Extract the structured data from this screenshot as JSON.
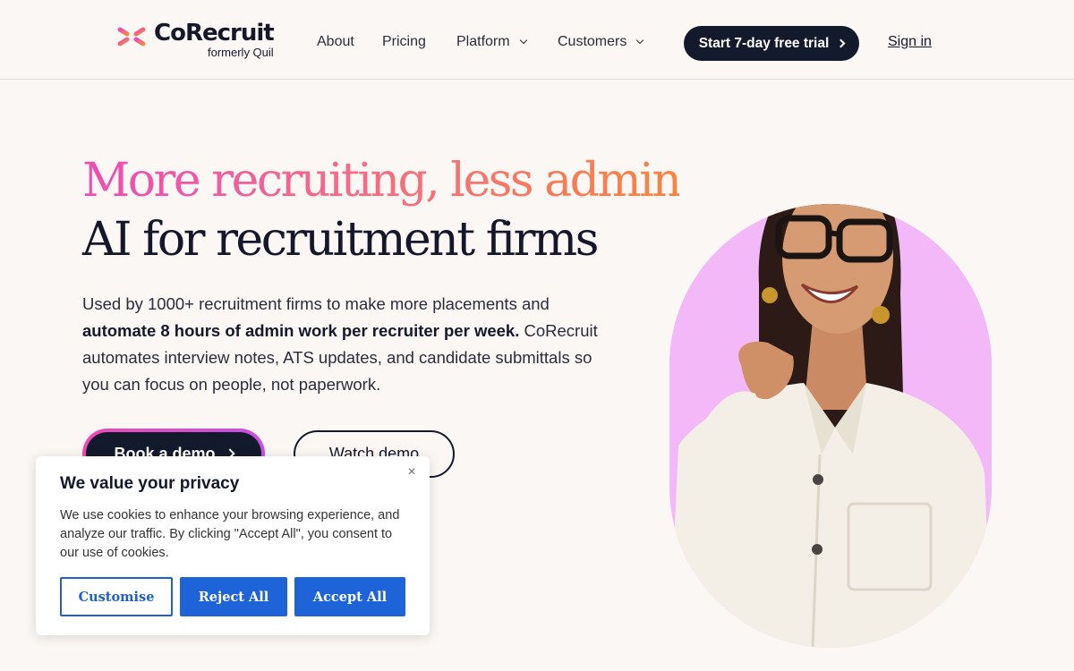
{
  "brand": {
    "name": "CoRecruit",
    "subtitle": "formerly Quil",
    "colors": {
      "pink": "#ef4bb4",
      "orange": "#f9843e",
      "navy": "#131a2b",
      "accent_blue": "#1f63d8"
    }
  },
  "nav": {
    "items": [
      {
        "label": "About",
        "has_dropdown": false
      },
      {
        "label": "Pricing",
        "has_dropdown": false
      },
      {
        "label": "Platform",
        "has_dropdown": true
      },
      {
        "label": "Customers",
        "has_dropdown": true
      }
    ],
    "cta_label": "Start 7-day free trial",
    "signin_label": "Sign in"
  },
  "hero": {
    "headline_gradient": "More recruiting, less admin",
    "headline": "AI for recruitment firms",
    "desc_part1": "Used by 1000+ recruitment firms to make more placements and ",
    "desc_bold": "automate 8 hours of admin work per recruiter per week.",
    "desc_part2": " CoRecruit automates interview notes, ATS updates, and candidate submittals so you can focus on people, not paperwork.",
    "primary_button": "Book a demo",
    "secondary_button": "Watch demo"
  },
  "cookie": {
    "title": "We value your privacy",
    "text": "We use cookies to enhance your browsing experience, and analyze our traffic. By clicking \"Accept All\", you consent to our use of cookies.",
    "close_icon": "×",
    "customise_label": "Customise",
    "reject_label": "Reject All",
    "accept_label": "Accept All"
  }
}
